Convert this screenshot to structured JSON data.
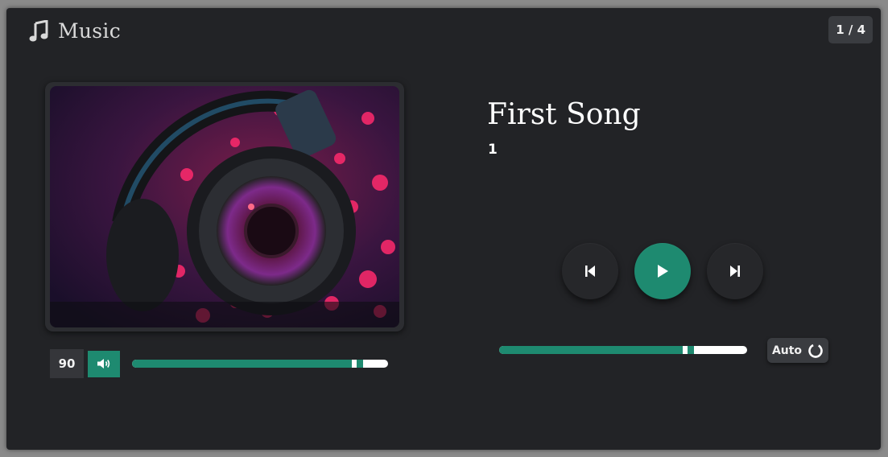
{
  "app": {
    "title": "Music",
    "track_counter": "1 / 4"
  },
  "track": {
    "title": "First Song",
    "artist": "1"
  },
  "volume": {
    "value": "90",
    "level": 0.86
  },
  "progress": {
    "level": 0.74
  },
  "controls": {
    "auto_label": "Auto"
  },
  "icons": {
    "app": "music-note-icon",
    "volume": "speaker-icon",
    "prev": "skip-previous-icon",
    "play": "play-icon",
    "next": "skip-next-icon",
    "auto": "loop-ring-icon"
  },
  "colors": {
    "accent": "#1e8a70",
    "panel": "#222326",
    "track_bg": "#ffffff"
  }
}
